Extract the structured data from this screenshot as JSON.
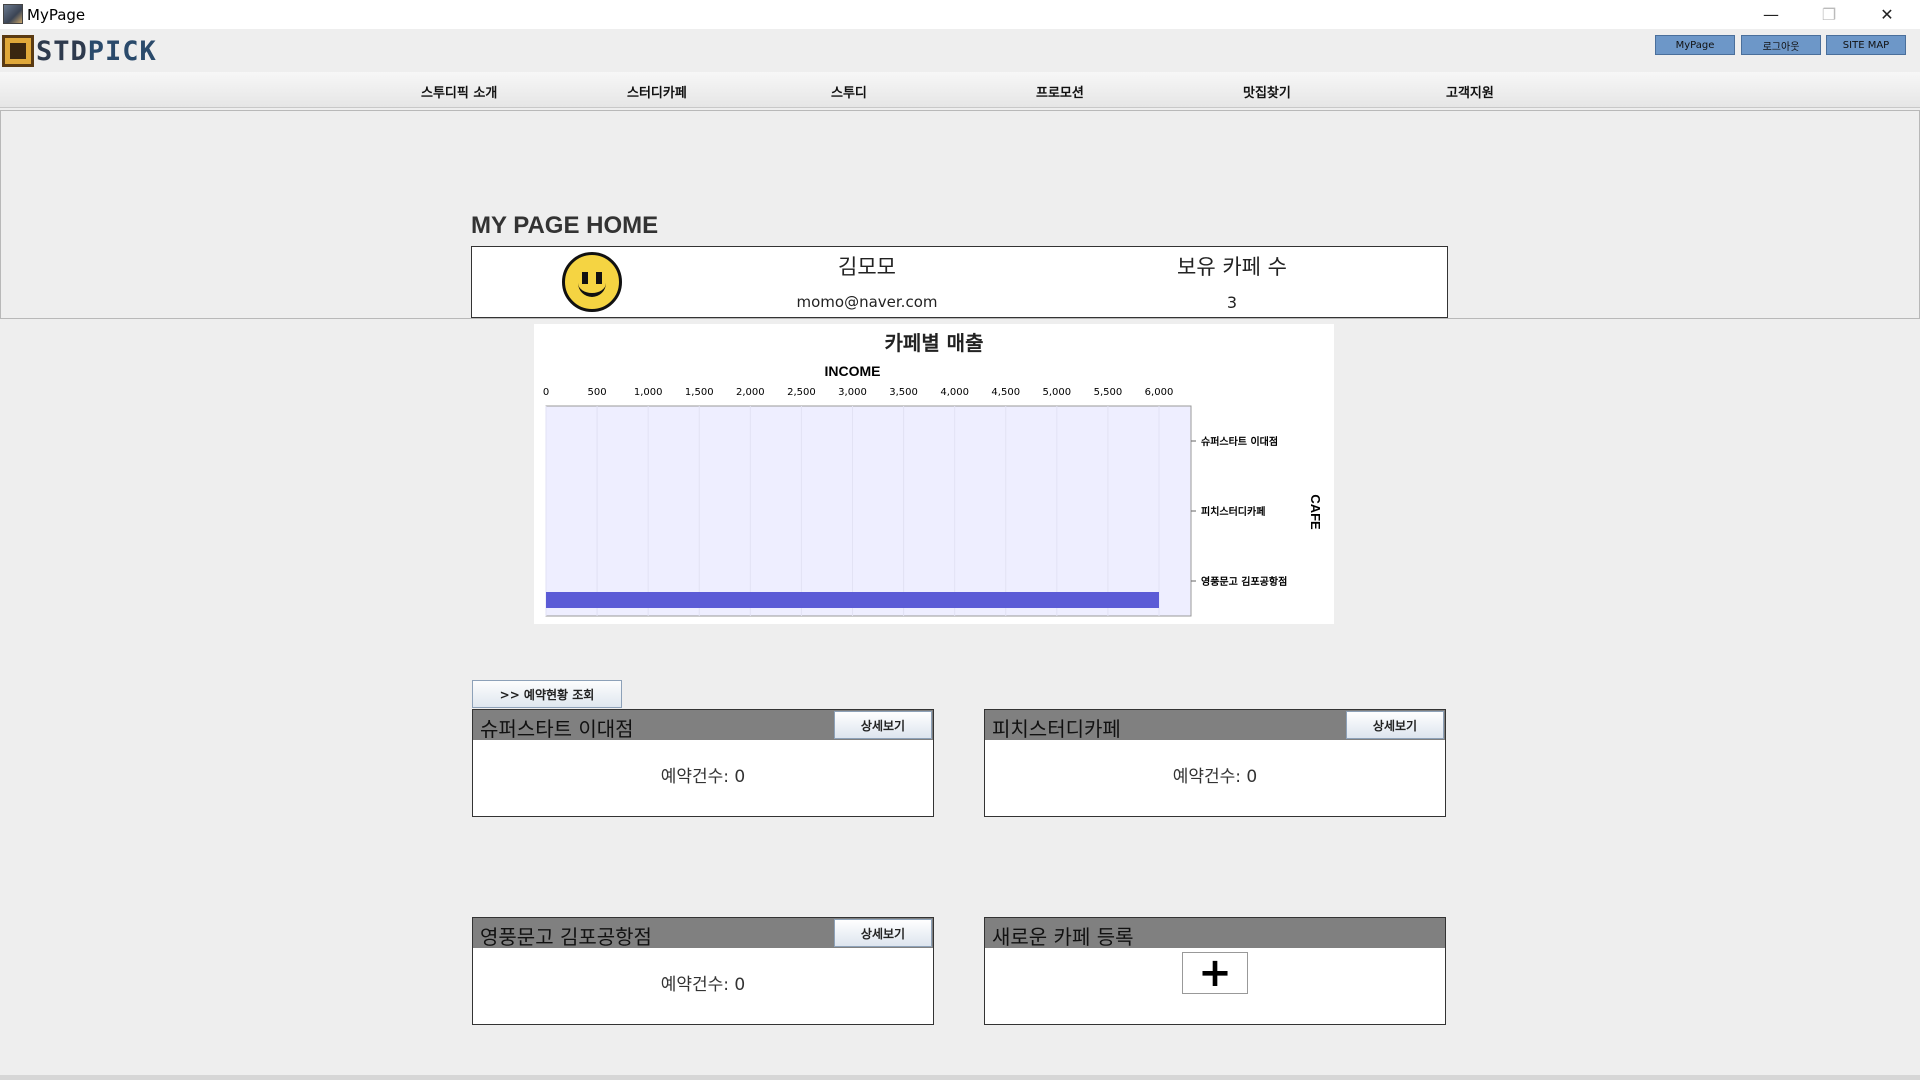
{
  "window": {
    "title": "MyPage",
    "minimize": "—",
    "maximize": "❐",
    "close": "✕"
  },
  "logo": {
    "std": "STD",
    "pick": "PICK"
  },
  "top_buttons": {
    "mypage": "MyPage",
    "logout": "로그아웃",
    "sitemap": "SITE MAP"
  },
  "nav": [
    "스투디픽 소개",
    "스터디카페",
    "스투디",
    "프로모션",
    "맛집찾기",
    "고객지원"
  ],
  "page_title": "MY PAGE HOME",
  "profile": {
    "name": "김모모",
    "email": "momo@naver.com",
    "cafe_label": "보유 카페 수",
    "cafe_count": "3"
  },
  "colors": {
    "bar": "#5b5bd6",
    "plot_bg": "#eeeeff",
    "card_header": "#808080",
    "button_blue": "#6d97c8"
  },
  "chart_data": {
    "type": "bar",
    "orientation": "horizontal",
    "title": "카페별 매출",
    "xlabel": "INCOME",
    "ylabel": "CAFE",
    "x_axis_position": "top",
    "y_axis_position": "right",
    "xlim": [
      0,
      6000
    ],
    "xticks": [
      "0",
      "500",
      "1,000",
      "1,500",
      "2,000",
      "2,500",
      "3,000",
      "3,500",
      "4,000",
      "4,500",
      "5,000",
      "5,500",
      "6,000"
    ],
    "categories": [
      "슈퍼스타트 이대점",
      "피치스터디카페",
      "영풍문고 김포공항점"
    ],
    "values": [
      0,
      0,
      6000
    ],
    "grid": true
  },
  "reserve_button": ">> 예약현황 조회",
  "cards": [
    {
      "name": "슈퍼스타트 이대점",
      "button": "상세보기",
      "count": "예약건수: 0"
    },
    {
      "name": "피치스터디카페",
      "button": "상세보기",
      "count": "예약건수: 0"
    },
    {
      "name": "영풍문고 김포공항점",
      "button": "상세보기",
      "count": "예약건수: 0"
    }
  ],
  "new_card": {
    "name": "새로운 카페 등록",
    "button": "+"
  }
}
